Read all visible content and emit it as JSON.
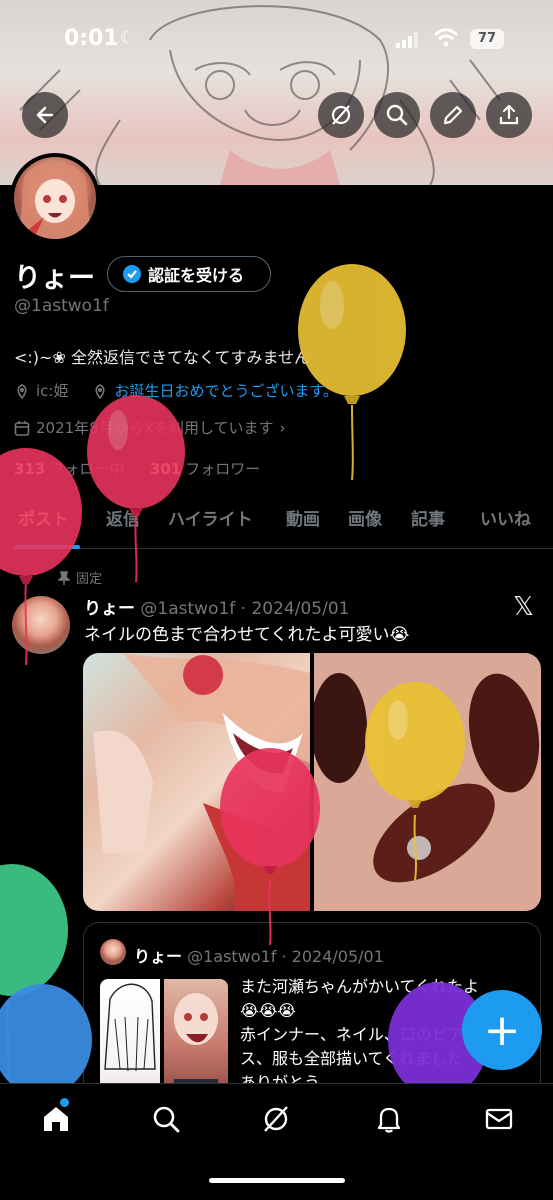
{
  "status_bar": {
    "time": "0:01",
    "battery": "77"
  },
  "profile": {
    "name": "りょー",
    "verify_button": "認証を受ける",
    "handle": "@1astwo1f",
    "bio": "<:)~❀ 全然返信できてなくてすみません",
    "location": "ic:姫",
    "birthday_link": "お誕生日おめでとうございます。",
    "joined": "2021年8月からXを利用しています",
    "following_count": "313",
    "following_label": "フォロー中",
    "followers_count": "301",
    "followers_label": "フォロワー"
  },
  "tabs": [
    "ポスト",
    "返信",
    "ハイライト",
    "動画",
    "画像",
    "記事",
    "いいね"
  ],
  "pinned_label": "固定",
  "post": {
    "author": "りょー",
    "meta": "@1astwo1f · 2024/05/01",
    "text": "ネイルの色まで合わせてくれたよ可愛い😭"
  },
  "quoted_post": {
    "author": "りょー",
    "meta": "@1astwo1f · 2024/05/01",
    "line1": "また河瀬ちゃんがかいてくれたよ",
    "line2": "😭😭😭",
    "line3": "赤インナー、ネイル、口のピア",
    "line4": "ス、服も全部描いてくれました",
    "line5": "ありがとう"
  },
  "fab_label": "+",
  "icons": [
    "back-icon",
    "grok-icon",
    "search-icon",
    "edit-icon",
    "share-icon",
    "home-icon",
    "search-icon",
    "grok-icon",
    "bell-icon",
    "mail-icon",
    "pin-icon",
    "location-icon",
    "calendar-icon",
    "x-logo-icon",
    "verified-icon"
  ],
  "colors": {
    "accent": "#1d9bf0",
    "balloon_yellow": "#e9c232",
    "balloon_red": "#e8345c",
    "balloon_green": "#3dc585",
    "balloon_blue": "#3a8be0",
    "balloon_purple": "#7a2fd6"
  }
}
